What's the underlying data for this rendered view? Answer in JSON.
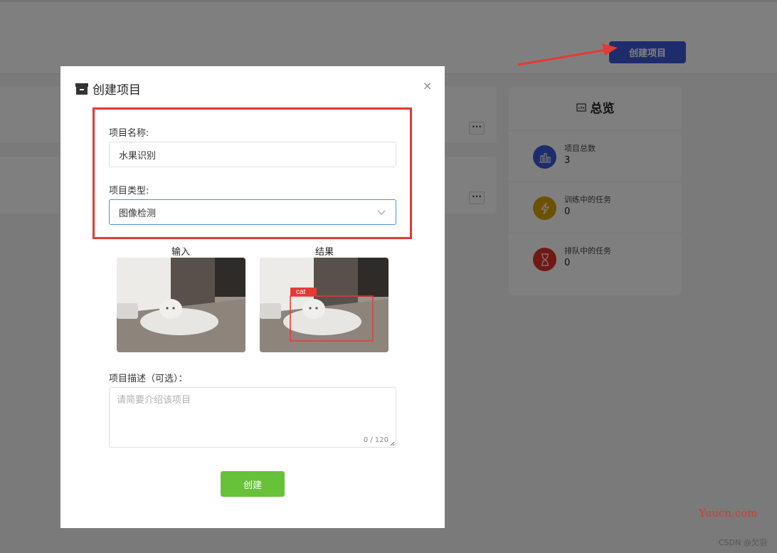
{
  "header": {
    "create_button": "创建项目"
  },
  "project_cards": [
    {
      "more": "•••"
    },
    {
      "more": "•••"
    }
  ],
  "overview": {
    "title": "总览",
    "items": [
      {
        "label": "项目总数",
        "value": "3",
        "color": "#3a5bd9",
        "icon": "bar-chart-icon"
      },
      {
        "label": "训练中的任务",
        "value": "0",
        "color": "#d9a200",
        "icon": "lightning-icon"
      },
      {
        "label": "排队中的任务",
        "value": "0",
        "color": "#e0312a",
        "icon": "hourglass-icon"
      }
    ]
  },
  "modal": {
    "title": "创建项目",
    "close": "×",
    "name_label": "项目名称:",
    "name_value": "水果识别",
    "type_label": "项目类型:",
    "type_value": "图像检测",
    "input_caption": "输入",
    "result_caption": "结果",
    "detection_label": "cat",
    "desc_label": "项目描述（可选）：",
    "desc_placeholder": "请简要介绍该项目",
    "desc_count": "0 / 120",
    "submit": "创建"
  },
  "watermark": {
    "site": "Yuucn.com",
    "author": "CSDN @欠羽"
  },
  "colors": {
    "primary": "#3a5bd9",
    "success": "#67c23a",
    "highlight": "#e53935"
  }
}
